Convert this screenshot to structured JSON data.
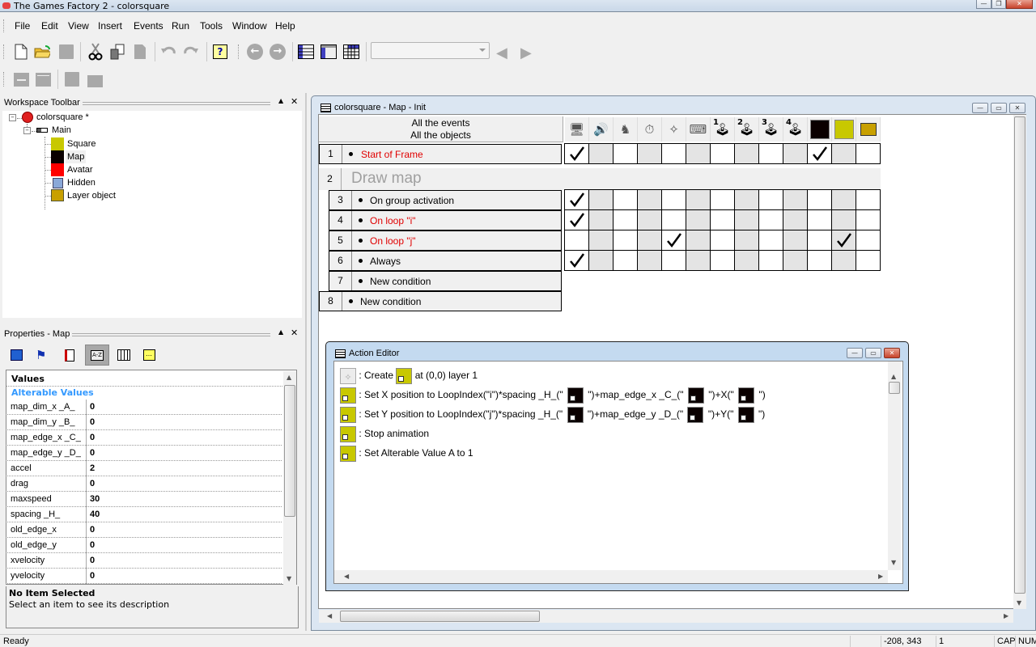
{
  "window": {
    "title": "The Games Factory 2 - colorsquare",
    "controls": {
      "minimize": "—",
      "restore": "❐",
      "close": "✕"
    }
  },
  "menubar": {
    "items": [
      {
        "label": "File",
        "accel": "F"
      },
      {
        "label": "Edit",
        "accel": "E"
      },
      {
        "label": "View",
        "accel": "V"
      },
      {
        "label": "Insert",
        "accel": "I"
      },
      {
        "label": "Events",
        "accel": "t"
      },
      {
        "label": "Run",
        "accel": "R"
      },
      {
        "label": "Tools",
        "accel": "T"
      },
      {
        "label": "Window",
        "accel": "W"
      },
      {
        "label": "Help",
        "accel": "H"
      }
    ]
  },
  "toolbar": {
    "icons": [
      "new-file-icon",
      "open-folder-icon",
      "save-icon",
      "cut-icon",
      "copy-icon",
      "paste-icon",
      "undo-icon",
      "redo-icon",
      "help-icon",
      "back-icon",
      "forward-icon",
      "event-list-icon",
      "frame-editor-icon",
      "event-editor-icon"
    ],
    "combo_value": "",
    "nav_prev": "◀",
    "nav_next": "▶",
    "back_glyph": "←",
    "forward_glyph": "→",
    "help_glyph": "?"
  },
  "workspace": {
    "title": "Workspace Toolbar",
    "tree": {
      "application": "colorsquare *",
      "frame": "Main",
      "objects": [
        {
          "name": "Square",
          "color": "#c8c800"
        },
        {
          "name": "Map",
          "color": "#0a0000"
        },
        {
          "name": "Avatar",
          "color": "#ff0000"
        },
        {
          "name": "Hidden",
          "color": "#8aa8d8"
        },
        {
          "name": "Layer object",
          "color": "#c8a000"
        }
      ]
    }
  },
  "properties": {
    "title": "Properties - Map",
    "tabs": [
      "display-tab",
      "movement-tab",
      "runtime-options-tab",
      "values-tab",
      "events-tab",
      "about-tab"
    ],
    "active_tab": "values-tab",
    "section": "Values",
    "subsection": "Alterable Values",
    "rows": [
      {
        "key": "map_dim_x _A_",
        "value": "0"
      },
      {
        "key": "map_dim_y _B_",
        "value": "0"
      },
      {
        "key": "map_edge_x _C_",
        "value": "0"
      },
      {
        "key": "map_edge_y _D_",
        "value": "0"
      },
      {
        "key": "accel",
        "value": "2"
      },
      {
        "key": "drag",
        "value": "0"
      },
      {
        "key": "maxspeed",
        "value": "30"
      },
      {
        "key": "spacing _H_",
        "value": "40"
      },
      {
        "key": "old_edge_x",
        "value": "0"
      },
      {
        "key": "old_edge_y",
        "value": "0"
      },
      {
        "key": "xvelocity",
        "value": "0"
      },
      {
        "key": "yvelocity",
        "value": "0"
      }
    ],
    "description_title": "No Item Selected",
    "description_text": "Select an item to see its description"
  },
  "event_editor": {
    "title": "colorsquare - Map - Init",
    "header_line1": "All the events",
    "header_line2": "All the objects",
    "object_columns": [
      "special-conditions-icon",
      "sound-icon",
      "storyboard-controls-icon",
      "timer-icon",
      "create-new-objects-icon",
      "mouse-keyboard-icon",
      "player-1-icon",
      "player-2-icon",
      "player-3-icon",
      "player-4-icon",
      "map-object",
      "square-object",
      "layer-object-icon"
    ],
    "player_labels": [
      "1",
      "2",
      "3",
      "4"
    ],
    "map_color": "#0a0000",
    "square_color": "#c8c800",
    "events": [
      {
        "num": "1",
        "text": "Start of Frame",
        "red": true,
        "indent": 0,
        "checks": [
          0,
          10
        ]
      },
      {
        "num": "2",
        "group": "Draw map"
      },
      {
        "num": "3",
        "text": "On group activation",
        "red": false,
        "indent": 1,
        "checks": [
          0
        ]
      },
      {
        "num": "4",
        "text": "On loop \"i\"",
        "red": true,
        "indent": 1,
        "checks": [
          0
        ]
      },
      {
        "num": "5",
        "text": "On loop \"j\"",
        "red": true,
        "indent": 1,
        "checks": [
          4,
          11
        ]
      },
      {
        "num": "6",
        "text": "Always",
        "red": false,
        "indent": 1,
        "checks": [
          0
        ]
      },
      {
        "num": "7",
        "text": "New condition",
        "red": false,
        "indent": 1,
        "checks": null
      },
      {
        "num": "8",
        "text": "New condition",
        "red": false,
        "indent": 0,
        "checks": null
      }
    ]
  },
  "action_editor": {
    "title": "Action Editor",
    "actions": [
      {
        "pre": ": Create",
        "post": "at (0,0) layer 1"
      },
      {
        "pre": ": Set X position to LoopIndex(\"i\")*spacing _H_(\"",
        "m1": "\")+map_edge_x _C_(\"",
        "m2": "\")+X(\"",
        "end": "\")"
      },
      {
        "pre": ": Set Y position to LoopIndex(\"j\")*spacing _H_(\"",
        "m1": "\")+map_edge_y _D_(\"",
        "m2": "\")+Y(\"",
        "end": "\")"
      },
      {
        "pre": ": Stop animation"
      },
      {
        "pre": ": Set Alterable Value A to 1"
      }
    ]
  },
  "statusbar": {
    "status": "Ready",
    "coords": "-208, 343",
    "layer": "1",
    "cap": "CAP",
    "num": "NUM"
  }
}
